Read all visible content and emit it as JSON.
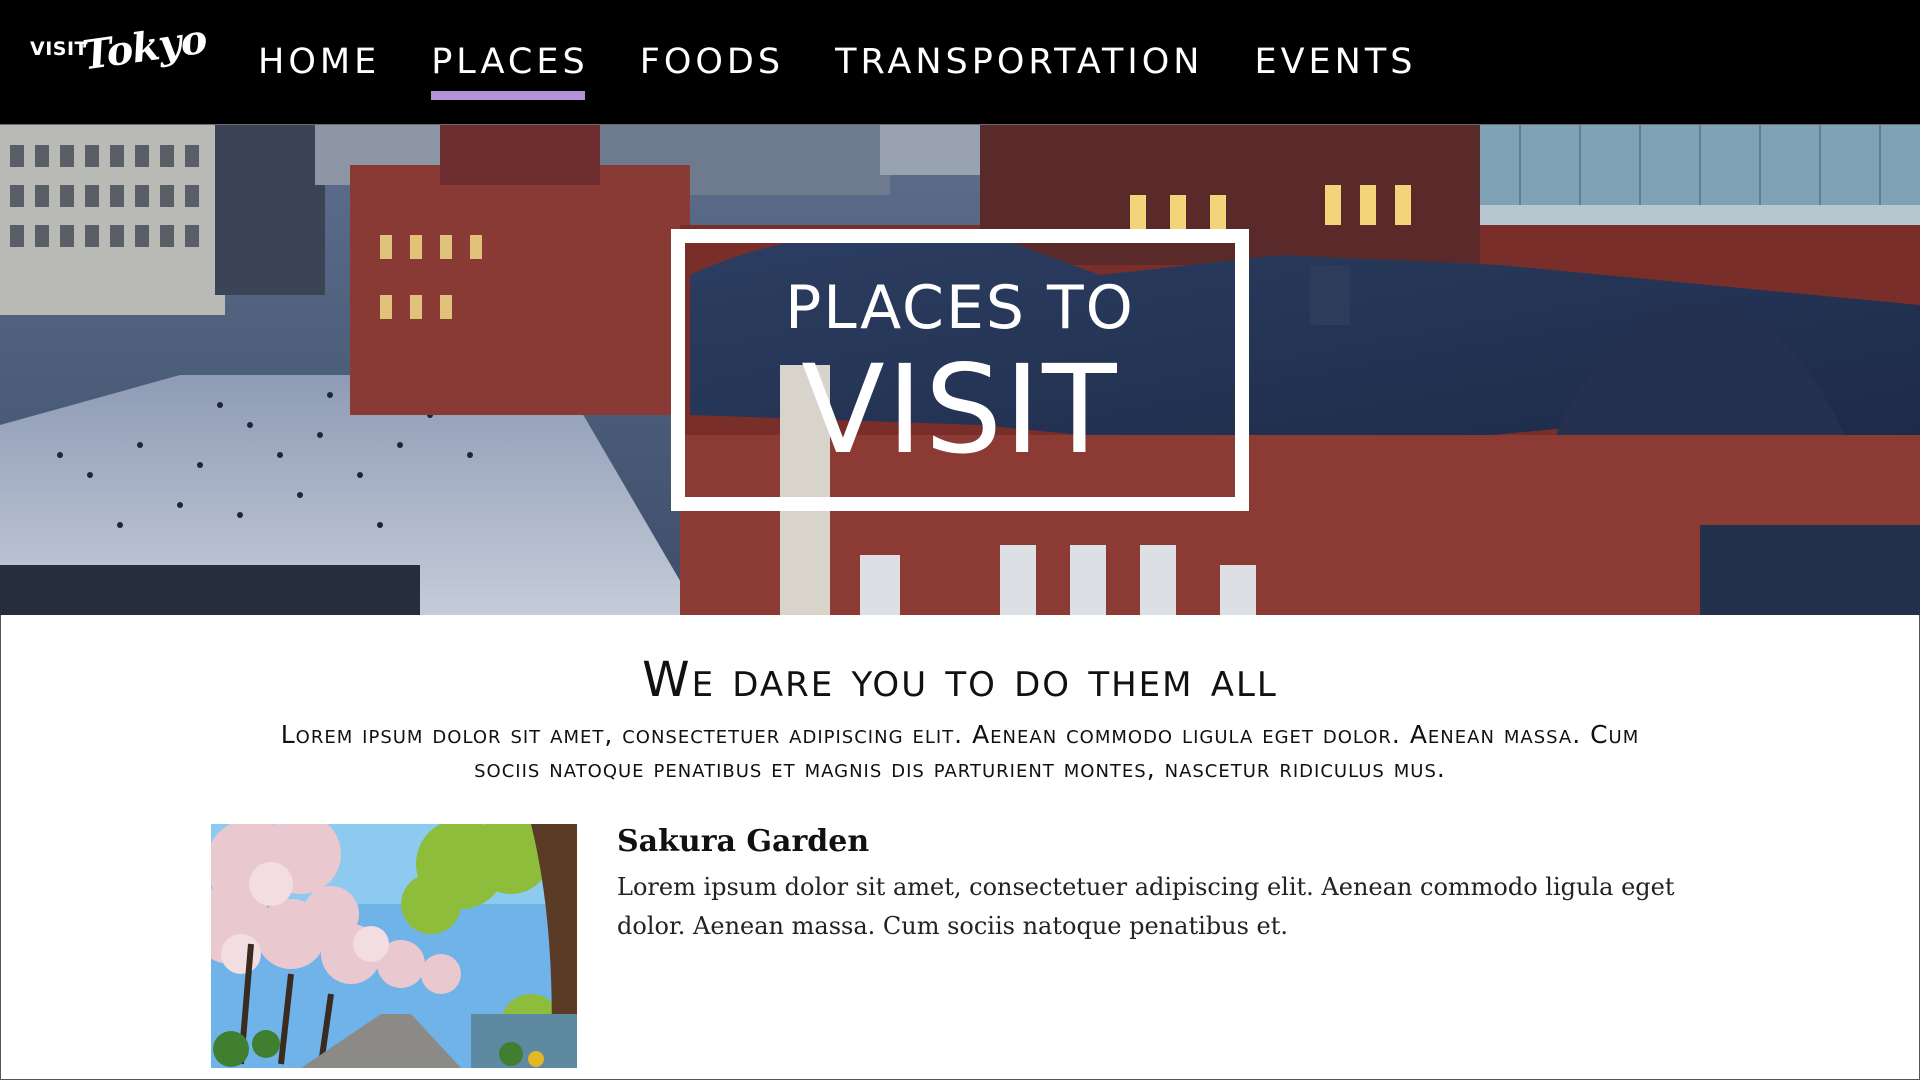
{
  "logo": {
    "visit": "VISIT",
    "city": "Tokyo"
  },
  "nav": {
    "items": [
      {
        "label": "HOME"
      },
      {
        "label": "PLACES"
      },
      {
        "label": "FOODS"
      },
      {
        "label": "TRANSPORTATION"
      },
      {
        "label": "EVENTS"
      }
    ],
    "active": "PLACES",
    "accent_color": "#b491d8"
  },
  "hero": {
    "line1": "PLACES TO",
    "line2": "VISIT"
  },
  "section": {
    "title": "We dare you to do them all",
    "description": "Lorem ipsum dolor sit amet, consectetuer adipiscing elit. Aenean commodo ligula eget dolor. Aenean massa. Cum sociis natoque penatibus et magnis dis parturient montes, nascetur ridiculus mus."
  },
  "places": [
    {
      "title": "Sakura Garden",
      "description": "Lorem ipsum dolor sit amet, consectetuer adipiscing elit. Aenean commodo ligula eget dolor. Aenean massa. Cum sociis natoque penatibus et."
    }
  ]
}
